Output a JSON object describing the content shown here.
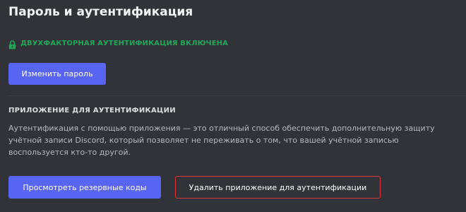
{
  "page": {
    "title": "Пароль и аутентификация"
  },
  "status": {
    "text": "ДВУХФАКТОРНАЯ АУТЕНТИФИКАЦИЯ ВКЛЮЧЕНА",
    "icon": "lock-icon",
    "color": "#23a55a"
  },
  "buttons": {
    "change_password": "Изменить пароль",
    "view_backup_codes": "Просмотреть резервные коды",
    "remove_authenticator": "Удалить приложение для аутентификации"
  },
  "auth_app": {
    "heading": "ПРИЛОЖЕНИЕ ДЛЯ АУТЕНТИФИКАЦИИ",
    "description_lines": [
      "Аутентификация с помощью приложения — это отличный способ обеспечить дополнительную защиту",
      "учётной записи Discord, который позволяет не переживать о том, что вашей учётной записью",
      "воспользуется кто-то другой."
    ]
  },
  "colors": {
    "background": "#313338",
    "brand": "#5865f2",
    "danger": "#da373c",
    "success": "#23a55a"
  }
}
